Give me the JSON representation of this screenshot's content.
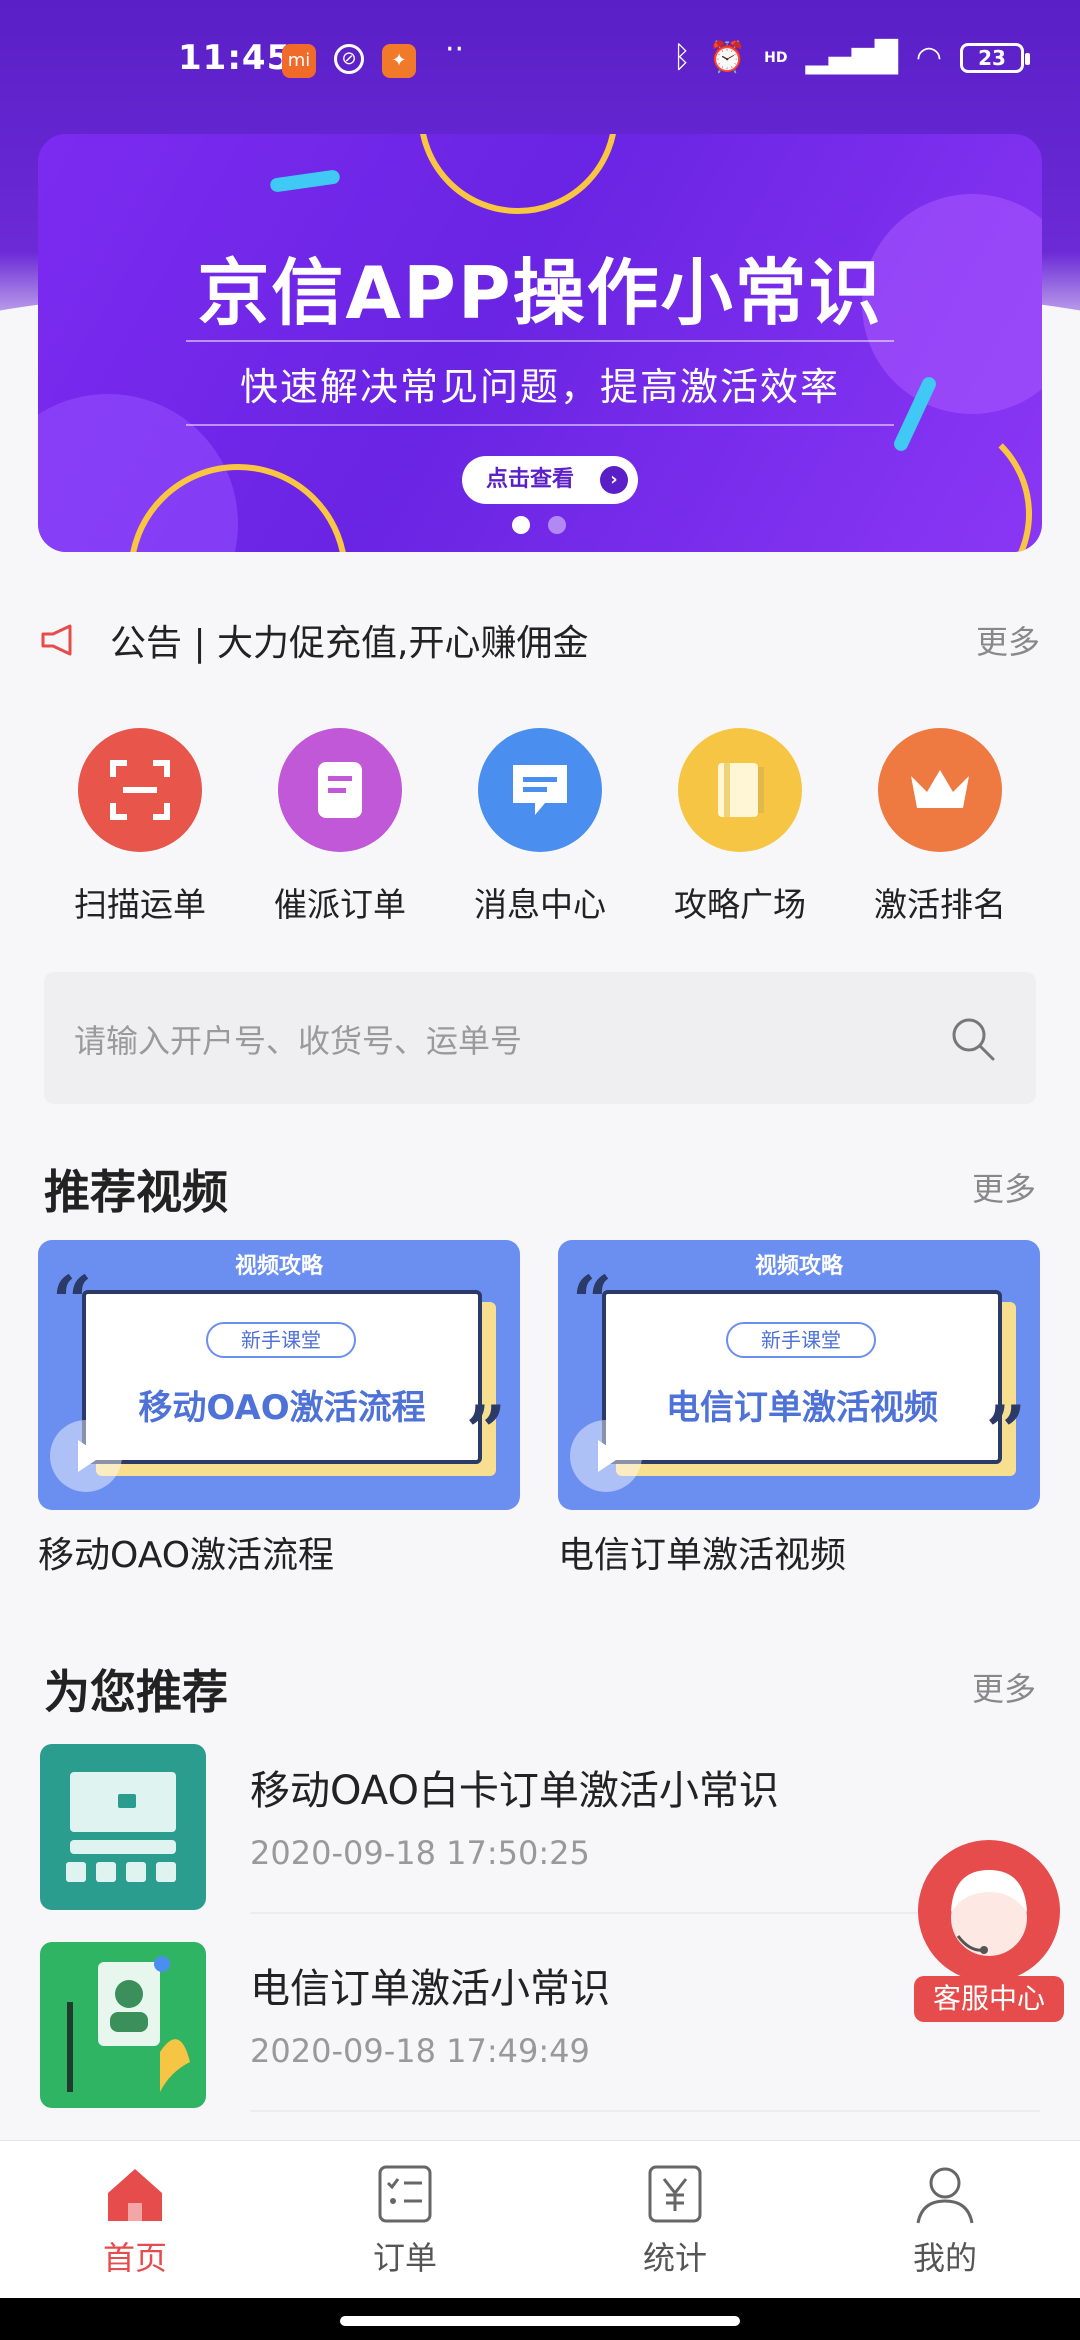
{
  "status_bar": {
    "time": "11:45",
    "battery": "23",
    "network": "HD"
  },
  "banner": {
    "title": "京信APP操作小常识",
    "subtitle": "快速解决常见问题，提高激活效率",
    "cta": "点击查看",
    "slide_count": 2,
    "active_slide": 1
  },
  "notice": {
    "text": "公告 | 大力促充值,开心赚佣金",
    "more": "更多"
  },
  "menu": [
    {
      "label": "扫描运单",
      "icon": "scan-icon",
      "color": "#e8554b"
    },
    {
      "label": "催派订单",
      "icon": "document-icon",
      "color": "#c058d8"
    },
    {
      "label": "消息中心",
      "icon": "message-icon",
      "color": "#4a8ff0"
    },
    {
      "label": "攻略广场",
      "icon": "book-icon",
      "color": "#f6c543"
    },
    {
      "label": "激活排名",
      "icon": "crown-icon",
      "color": "#ee7a42"
    }
  ],
  "search": {
    "placeholder": "请输入开户号、收货号、运单号"
  },
  "videos_section": {
    "title": "推荐视频",
    "more": "更多",
    "items": [
      {
        "tag": "视频攻略",
        "badge": "新手课堂",
        "thumb_title": "移动OAO激活流程",
        "caption": "移动OAO激活流程"
      },
      {
        "tag": "视频攻略",
        "badge": "新手课堂",
        "thumb_title": "电信订单激活视频",
        "caption": "电信订单激活视频"
      }
    ]
  },
  "recommend_section": {
    "title": "为您推荐",
    "more": "更多",
    "items": [
      {
        "title": "移动OAO白卡订单激活小常识",
        "date": "2020-09-18 17:50:25",
        "bg": "#2a9d8f"
      },
      {
        "title": "电信订单激活小常识",
        "date": "2020-09-18 17:49:49",
        "bg": "#2fb463"
      }
    ]
  },
  "service": {
    "label": "客服中心"
  },
  "tabbar": [
    {
      "label": "首页",
      "icon": "home-icon",
      "active": true
    },
    {
      "label": "订单",
      "icon": "order-list-icon",
      "active": false
    },
    {
      "label": "统计",
      "icon": "yen-icon",
      "active": false
    },
    {
      "label": "我的",
      "icon": "person-icon",
      "active": false
    }
  ],
  "colors": {
    "brand_purple": "#6b2ad6",
    "accent_red": "#e74c4c"
  }
}
